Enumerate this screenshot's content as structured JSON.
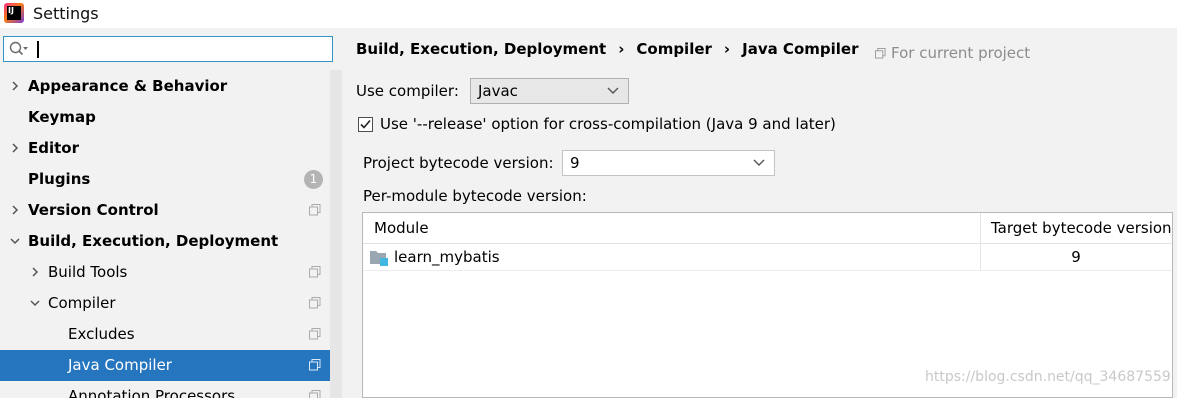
{
  "window": {
    "title": "Settings",
    "logo_text": "IJ"
  },
  "search": {
    "placeholder": "",
    "value": ""
  },
  "sidebar": {
    "items": [
      {
        "label": "Appearance & Behavior",
        "bold": true,
        "arrow": "right"
      },
      {
        "label": "Keymap",
        "bold": true,
        "arrow": "none"
      },
      {
        "label": "Editor",
        "bold": true,
        "arrow": "right"
      },
      {
        "label": "Plugins",
        "bold": true,
        "arrow": "none",
        "badge": "1"
      },
      {
        "label": "Version Control",
        "bold": true,
        "arrow": "right",
        "project_icon": true
      },
      {
        "label": "Build, Execution, Deployment",
        "bold": true,
        "arrow": "down"
      },
      {
        "label": "Build Tools",
        "bold": false,
        "arrow": "right",
        "project_icon": true
      },
      {
        "label": "Compiler",
        "bold": false,
        "arrow": "down",
        "project_icon": true
      },
      {
        "label": "Excludes",
        "bold": false,
        "arrow": "none",
        "project_icon": true
      },
      {
        "label": "Java Compiler",
        "bold": false,
        "arrow": "none",
        "project_icon": true,
        "selected": true
      },
      {
        "label": "Annotation Processors",
        "bold": false,
        "arrow": "none",
        "project_icon": true
      }
    ]
  },
  "breadcrumb": {
    "items": [
      "Build, Execution, Deployment",
      "Compiler",
      "Java Compiler"
    ],
    "separator": "›"
  },
  "for_current_project": "For current project",
  "compiler": {
    "use_compiler_label": "Use compiler:",
    "use_compiler_value": "Javac",
    "release_option_label": "Use '--release' option for cross-compilation (Java 9 and later)",
    "release_option_checked": true,
    "project_bytecode_label": "Project bytecode version:",
    "project_bytecode_value": "9",
    "per_module_label": "Per-module bytecode version:"
  },
  "module_table": {
    "headers": [
      "Module",
      "Target bytecode version"
    ],
    "rows": [
      {
        "module": "learn_mybatis",
        "target": "9"
      }
    ]
  },
  "watermark": "https://blog.csdn.net/qq_34687559",
  "colors": {
    "selection": "#2675bf",
    "focus_border": "#3592c4",
    "background": "#f2f2f2"
  }
}
